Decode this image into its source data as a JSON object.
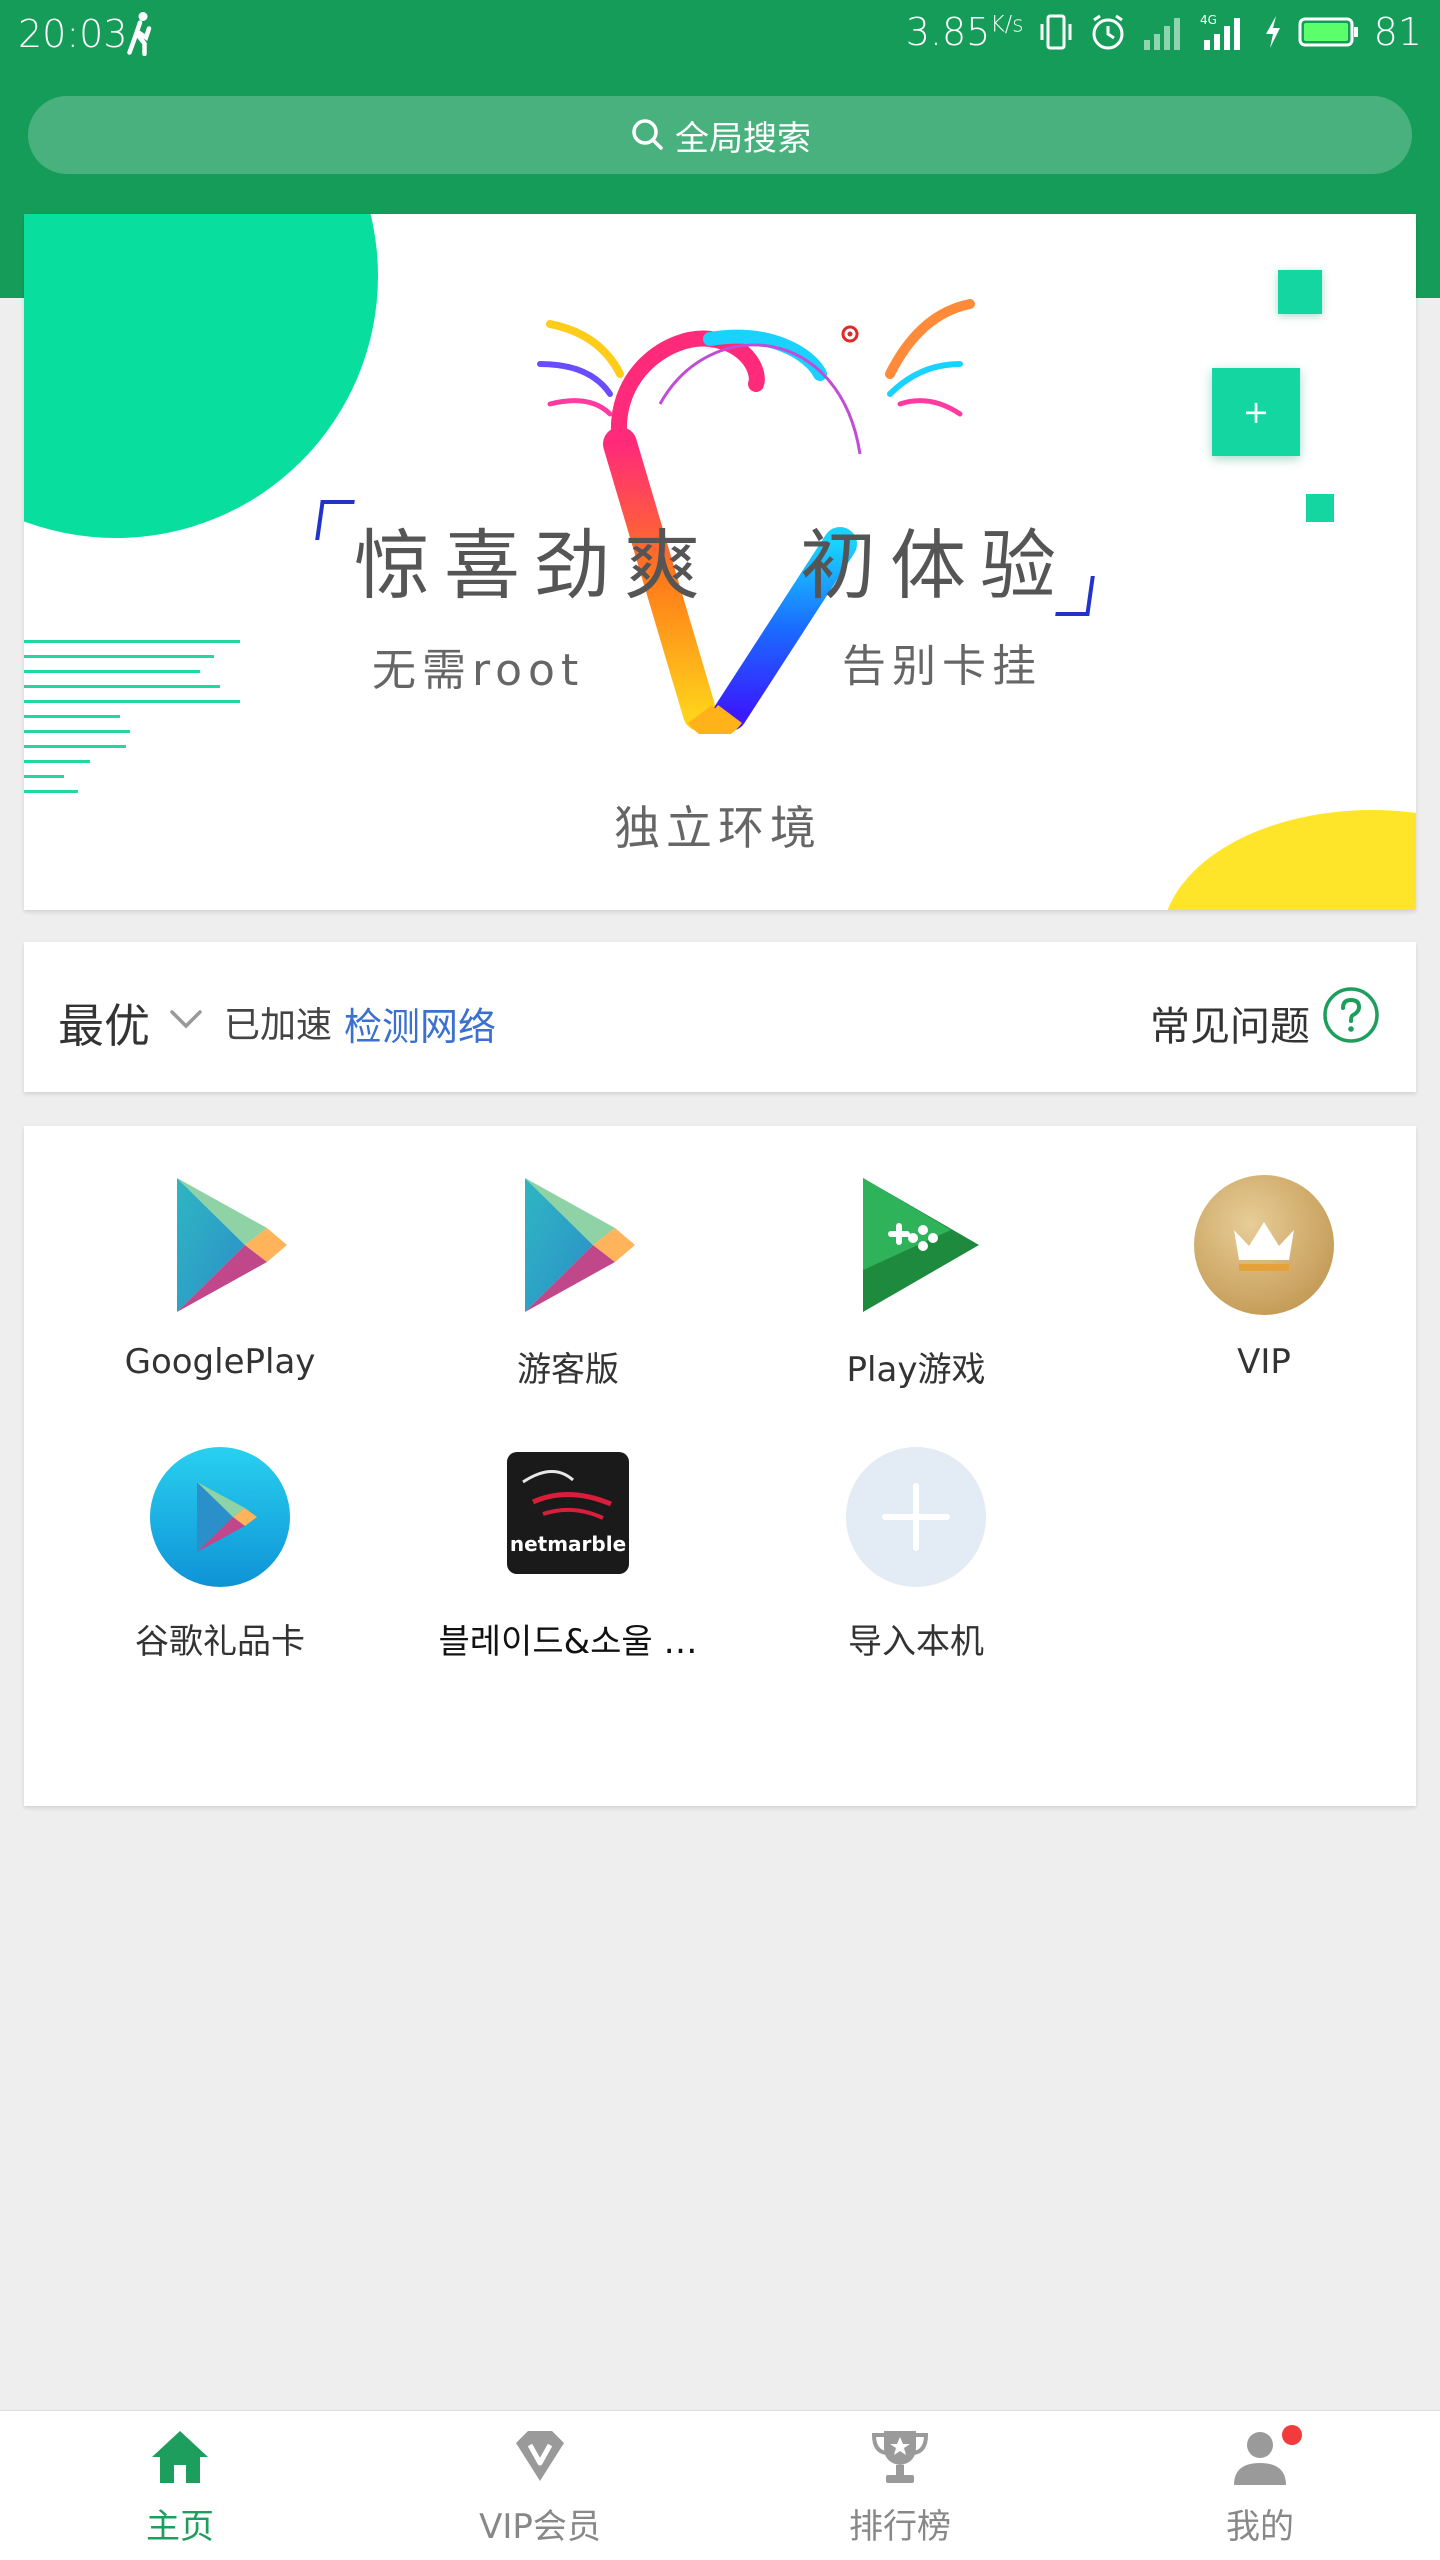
{
  "status_bar": {
    "time": "20:03",
    "net_speed": "3.85",
    "net_unit": "K/s",
    "battery": "81"
  },
  "search": {
    "placeholder": "全局搜索"
  },
  "banner": {
    "title_left": "惊喜劲爽",
    "title_right": "初体验",
    "sub_left": "无需root",
    "sub_right": "告别卡挂",
    "sub_bottom": "独立环境"
  },
  "network": {
    "mode": "最优",
    "status": "已加速",
    "detect_link": "检测网络",
    "faq": "常见问题"
  },
  "apps": [
    {
      "label": "GooglePlay",
      "icon": "google-play-icon"
    },
    {
      "label": "游客版",
      "icon": "google-play-icon"
    },
    {
      "label": "Play游戏",
      "icon": "play-games-icon"
    },
    {
      "label": "VIP",
      "icon": "crown-icon"
    },
    {
      "label": "谷歌礼品卡",
      "icon": "gift-card-play-icon"
    },
    {
      "label": "블레이드&소울 …",
      "icon": "blade-soul-icon"
    },
    {
      "label": "导入本机",
      "icon": "plus-icon"
    }
  ],
  "app_icon_text": {
    "netmarble": "netmarble"
  },
  "bottom_nav": [
    {
      "label": "主页",
      "icon": "home-icon",
      "active": true
    },
    {
      "label": "VIP会员",
      "icon": "vip-diamond-icon",
      "active": false
    },
    {
      "label": "排行榜",
      "icon": "trophy-icon",
      "active": false
    },
    {
      "label": "我的",
      "icon": "user-icon",
      "active": false
    }
  ],
  "colors": {
    "primary_green": "#169c59",
    "link_blue": "#3b6fd0",
    "accent_teal": "#08df9e",
    "accent_yellow": "#ffe52a",
    "background": "#eeeeee"
  }
}
